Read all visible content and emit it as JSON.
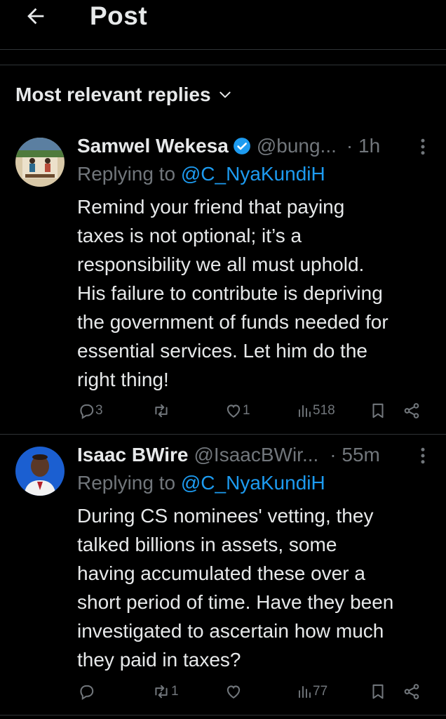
{
  "header": {
    "title": "Post",
    "back_icon": "arrow-left-icon"
  },
  "sort": {
    "label": "Most relevant replies",
    "icon": "chevron-down-icon"
  },
  "replies": [
    {
      "name": "Samwel Wekesa",
      "verified": true,
      "handle": "@bung...",
      "time": "· 1h",
      "replying_prefix": "Replying to ",
      "replying_to": "@C_NyaKundiH",
      "lines": [
        "Remind your friend that paying",
        "taxes is not optional; it’s a",
        "responsibility we all must uphold.",
        "His failure to contribute is depriving",
        "the government of funds needed for",
        "essential services. Let him do the",
        "right thing!"
      ],
      "stats": {
        "replies": "3",
        "reposts": "",
        "likes": "1",
        "views": "518"
      }
    },
    {
      "name": "Isaac BWire",
      "verified": false,
      "handle": "@IsaacBWir...",
      "time": "· 55m",
      "replying_prefix": "Replying to ",
      "replying_to": "@C_NyaKundiH",
      "lines": [
        "During CS nominees' vetting, they",
        "talked billions in assets, some",
        "having accumulated these over a",
        "short period of time. Have they been",
        "investigated to ascertain how much",
        "they paid in taxes?"
      ],
      "stats": {
        "replies": "",
        "reposts": "1",
        "likes": "",
        "views": "77"
      }
    }
  ],
  "colors": {
    "background": "#000000",
    "text": "#e7e9ea",
    "muted": "#71767b",
    "accent": "#1d9bf0",
    "divider": "#2f3336"
  }
}
